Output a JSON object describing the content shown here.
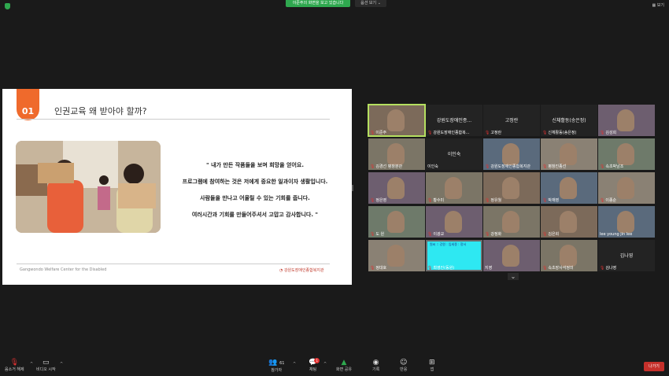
{
  "top": {
    "sharing_label": "이준주의 화면을 보고 있습니다",
    "view_options": "옵션 보기",
    "view_button": "보기"
  },
  "slide": {
    "number": "01",
    "title": "인권교육 왜 받아야 할까?",
    "lines": [
      "\" 내가 만든 작품들을 보며 희망을 얻어요.",
      "프로그램에 참여하는 것은 저에게 중요한 일과이자 생활입니다.",
      "사람들을 만나고 어울릴 수 있는 기회를 줍니다.",
      "여러시간과 기회를 만들어주셔서 고맙고 감사합니다. \""
    ],
    "footer": "Gangwondo Welfare Center for the Disabled",
    "logo": "강원도장애인종합복지관"
  },
  "gallery": {
    "tiles": [
      {
        "name": "이준주",
        "kind": "video",
        "active": true,
        "muted": true
      },
      {
        "name": "강원도장애인종합복...",
        "kind": "name",
        "title": "강원도장애인종...",
        "muted": true
      },
      {
        "name": "고정란",
        "kind": "name",
        "title": "고정란",
        "muted": true
      },
      {
        "name": "신체활동(송은정)",
        "kind": "name",
        "title": "신체활동(송은정)",
        "muted": true
      },
      {
        "name": "김성희",
        "kind": "video",
        "muted": true
      },
      {
        "name": "김경선 평창분관",
        "kind": "video",
        "muted": true
      },
      {
        "name": "이인숙",
        "kind": "name",
        "title": "이인숙",
        "muted": false
      },
      {
        "name": "강원도장애인종합복지관",
        "kind": "video",
        "muted": true
      },
      {
        "name": "평창진종선",
        "kind": "video",
        "muted": true
      },
      {
        "name": "속초박남조",
        "kind": "video",
        "muted": true
      },
      {
        "name": "정은영",
        "kind": "video",
        "muted": true
      },
      {
        "name": "황수미",
        "kind": "video",
        "muted": true
      },
      {
        "name": "정유월",
        "kind": "video",
        "muted": true
      },
      {
        "name": "박재영",
        "kind": "video",
        "muted": true
      },
      {
        "name": "이종순",
        "kind": "video",
        "muted": true
      },
      {
        "name": "도 원",
        "kind": "video",
        "muted": true
      },
      {
        "name": "이광교",
        "kind": "video",
        "muted": true
      },
      {
        "name": "강정화",
        "kind": "video",
        "muted": true
      },
      {
        "name": "김은희",
        "kind": "video",
        "muted": true
      },
      {
        "name": "lee young jin lee",
        "kind": "video",
        "muted": false
      },
      {
        "name": "정대호",
        "kind": "video",
        "muted": true
      },
      {
        "name": "최영진(동원)",
        "kind": "cyan",
        "muted": true,
        "note": "원씨 :: 강원 : 임세종 : 정서"
      },
      {
        "name": "지영",
        "kind": "video",
        "muted": false
      },
      {
        "name": "속초장사석정미",
        "kind": "video",
        "muted": true
      },
      {
        "name": "김나영",
        "kind": "name",
        "title": "김나영",
        "muted": true
      }
    ]
  },
  "toolbar": {
    "unmute": "음소거 해제",
    "video": "비디오 시작",
    "participants": "참가자",
    "participants_count": "61",
    "chat": "채팅",
    "chat_badge": "1",
    "share": "화면 공유",
    "record": "기록",
    "reactions": "반응",
    "apps": "앱",
    "leave": "나가기"
  },
  "colors": {
    "accent_green": "#2fa84f",
    "slide_orange": "#ef6a2c",
    "leave_red": "#c5302b"
  }
}
